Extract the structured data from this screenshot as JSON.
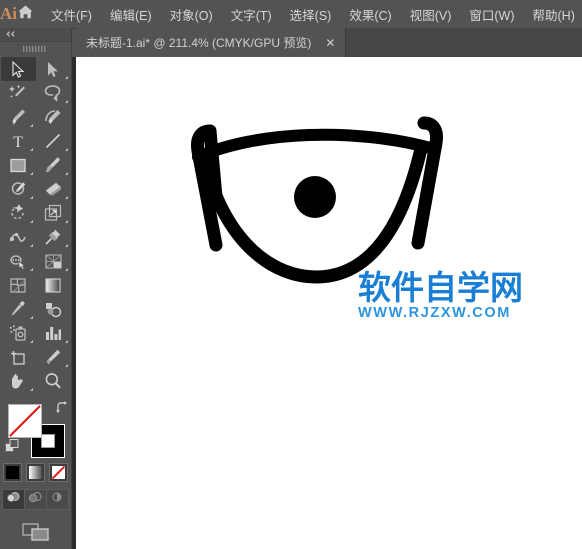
{
  "app": {
    "name": "Adobe Illustrator",
    "logo_text": "Ai",
    "logo_color": "#d08f5a"
  },
  "menubar": {
    "home_icon": "home-icon",
    "items": [
      {
        "label": "文件(F)",
        "name": "menu-file"
      },
      {
        "label": "编辑(E)",
        "name": "menu-edit"
      },
      {
        "label": "对象(O)",
        "name": "menu-object"
      },
      {
        "label": "文字(T)",
        "name": "menu-type"
      },
      {
        "label": "选择(S)",
        "name": "menu-select"
      },
      {
        "label": "效果(C)",
        "name": "menu-effect"
      },
      {
        "label": "视图(V)",
        "name": "menu-view"
      },
      {
        "label": "窗口(W)",
        "name": "menu-window"
      },
      {
        "label": "帮助(H)",
        "name": "menu-help"
      }
    ]
  },
  "tabbar": {
    "tabs": [
      {
        "title": "未标题-1.ai* @ 211.4% (CMYK/GPU 预览)",
        "close_label": "✕",
        "active": true,
        "document_name": "未标题-1.ai",
        "modified": true,
        "zoom": "211.4%",
        "color_mode": "CMYK",
        "preview_mode": "GPU 预览"
      }
    ]
  },
  "toolpanel": {
    "collapse_label": "«",
    "grip": "grip-dots",
    "tools": [
      {
        "name": "selection-tool",
        "icon": "arrow-solid-outline",
        "active": true,
        "corner": false
      },
      {
        "name": "direct-selection-tool",
        "icon": "arrow-solid",
        "active": false,
        "corner": true
      },
      {
        "name": "magic-wand-tool",
        "icon": "magic-wand",
        "active": false,
        "corner": false
      },
      {
        "name": "lasso-tool",
        "icon": "lasso",
        "active": false,
        "corner": true
      },
      {
        "name": "pen-tool",
        "icon": "pen",
        "active": false,
        "corner": true
      },
      {
        "name": "curvature-tool",
        "icon": "curvature",
        "active": false,
        "corner": false
      },
      {
        "name": "type-tool",
        "icon": "type-T",
        "active": false,
        "corner": true
      },
      {
        "name": "line-segment-tool",
        "icon": "line-segment",
        "active": false,
        "corner": true
      },
      {
        "name": "rectangle-tool",
        "icon": "rectangle",
        "active": false,
        "corner": true
      },
      {
        "name": "paintbrush-tool",
        "icon": "paintbrush",
        "active": false,
        "corner": true
      },
      {
        "name": "shaper-tool",
        "icon": "shaper-pencil",
        "active": false,
        "corner": true
      },
      {
        "name": "eraser-tool",
        "icon": "eraser",
        "active": false,
        "corner": true
      },
      {
        "name": "rotate-tool",
        "icon": "rotate",
        "active": false,
        "corner": true
      },
      {
        "name": "scale-tool",
        "icon": "scale",
        "active": false,
        "corner": true
      },
      {
        "name": "width-tool",
        "icon": "width-warp",
        "active": false,
        "corner": true
      },
      {
        "name": "free-transform-tool",
        "icon": "pushpin",
        "active": false,
        "corner": true
      },
      {
        "name": "shape-builder-tool",
        "icon": "shape-builder",
        "active": false,
        "corner": true
      },
      {
        "name": "perspective-grid-tool",
        "icon": "perspective-grid",
        "active": false,
        "corner": true
      },
      {
        "name": "mesh-tool",
        "icon": "mesh",
        "active": false,
        "corner": false
      },
      {
        "name": "gradient-tool",
        "icon": "gradient-square",
        "active": false,
        "corner": false
      },
      {
        "name": "eyedropper-tool",
        "icon": "eyedropper",
        "active": false,
        "corner": true
      },
      {
        "name": "blend-tool",
        "icon": "blend",
        "active": false,
        "corner": false
      },
      {
        "name": "symbol-sprayer-tool",
        "icon": "symbol-sprayer",
        "active": false,
        "corner": true
      },
      {
        "name": "column-graph-tool",
        "icon": "bar-graph",
        "active": false,
        "corner": true
      },
      {
        "name": "artboard-tool",
        "icon": "artboard",
        "active": false,
        "corner": false
      },
      {
        "name": "slice-tool",
        "icon": "slice-knife",
        "active": false,
        "corner": true
      },
      {
        "name": "hand-tool",
        "icon": "hand",
        "active": false,
        "corner": true
      },
      {
        "name": "zoom-tool",
        "icon": "magnifier",
        "active": false,
        "corner": false
      }
    ],
    "fill_stroke": {
      "fill_name": "fill-swatch",
      "fill_value": "none",
      "fill_color": "#ffffff",
      "stroke_name": "stroke-swatch",
      "stroke_color": "#000000",
      "swap_icon": "swap-arrow-icon",
      "default_icon": "default-fill-stroke-icon"
    },
    "color_modes": [
      {
        "name": "color-button",
        "icon": "solid-color-swatch",
        "active": false
      },
      {
        "name": "gradient-button",
        "icon": "gradient-swatch",
        "active": false
      },
      {
        "name": "none-button",
        "icon": "none-swatch",
        "active": true
      }
    ],
    "draw_modes": [
      {
        "name": "draw-normal-button",
        "icon": "draw-normal-icon",
        "active": true
      },
      {
        "name": "draw-behind-button",
        "icon": "draw-behind-icon",
        "active": false
      },
      {
        "name": "draw-inside-button",
        "icon": "draw-inside-icon",
        "active": false
      }
    ],
    "screen_mode": {
      "name": "change-screen-mode-button",
      "icon": "screen-mode-icon"
    }
  },
  "canvas": {
    "background": "#ffffff",
    "artwork": {
      "name": "eye-glasses-artwork",
      "stroke_color": "#000000",
      "pupil_color": "#000000",
      "description": "eye-shape with brow bar and side hooks"
    },
    "watermark": {
      "cn_text": "软件自学网",
      "en_text": "WWW.RJZXW.COM",
      "cn_color": "#1a7fd4",
      "en_color": "#2d95e0"
    }
  }
}
